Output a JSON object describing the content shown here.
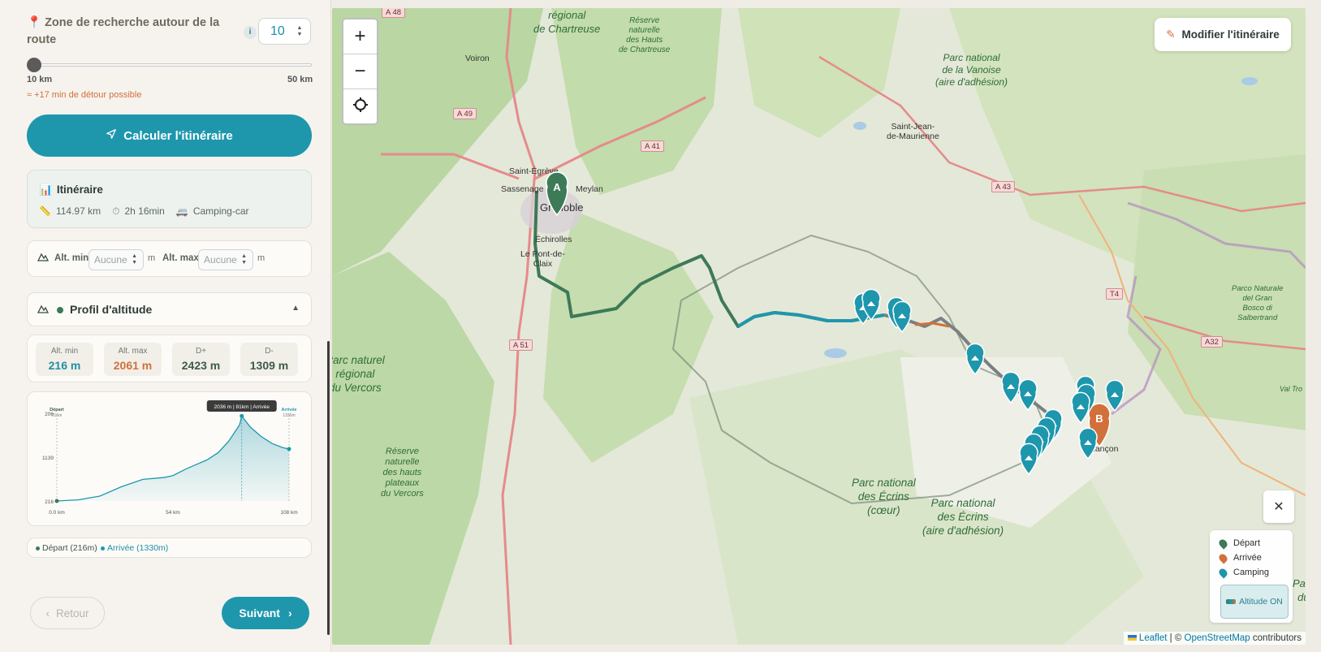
{
  "search_zone": {
    "title": "Zone de recherche autour de la route",
    "info": "i",
    "value": "10",
    "slider_min": "10 km",
    "slider_max": "50 km",
    "slider_level_fraction": 0,
    "detour": "≈ +17 min de détour possible"
  },
  "calc_button": "Calculer l'itinéraire",
  "itinerary": {
    "title": "Itinéraire",
    "distance": "114.97 km",
    "duration": "2h 16min",
    "vehicle": "Camping-car"
  },
  "alt_filter": {
    "min_label": "Alt. min",
    "min_placeholder": "Aucune",
    "max_label": "Alt. max",
    "max_placeholder": "Aucune",
    "unit": "m"
  },
  "profile": {
    "title": "Profil d'altitude",
    "stats": [
      {
        "label": "Alt. min",
        "value": "216 m",
        "color": "#1e8fa6"
      },
      {
        "label": "Alt. max",
        "value": "2061 m",
        "color": "#d2703b"
      },
      {
        "label": "D+",
        "value": "2423 m",
        "color": "#3d5a4c"
      },
      {
        "label": "D-",
        "value": "1309 m",
        "color": "#3d5a4c"
      }
    ],
    "legend_depart": "Départ (216m)",
    "legend_arrivee": "Arrivée (1330m)"
  },
  "chart_data": {
    "type": "area",
    "x": [
      0,
      10,
      20,
      30,
      40,
      50,
      54,
      60,
      65,
      70,
      75,
      80,
      85,
      86,
      90,
      95,
      100,
      105,
      108
    ],
    "y": [
      216,
      240,
      320,
      520,
      680,
      720,
      760,
      900,
      1000,
      1100,
      1250,
      1500,
      1850,
      2036,
      1800,
      1600,
      1450,
      1360,
      1330
    ],
    "ylim": [
      216,
      2061
    ],
    "y_ticks": [
      "206",
      "1139",
      "216"
    ],
    "x_ticks": [
      "0.0 km",
      "54 km",
      "108 km"
    ],
    "start_label": "Départ",
    "start_sub": "216m",
    "end_label": "Arrivée",
    "end_sub": "1330m",
    "tooltip": "2036 m | 81km | Arrivée",
    "color": "#1e97ad"
  },
  "nav": {
    "back": "Retour",
    "next": "Suivant"
  },
  "map": {
    "modify": "Modifier l'itinéraire",
    "zoom_in": "+",
    "zoom_out": "−",
    "legend": {
      "depart": "Départ",
      "arrivee": "Arrivée",
      "camping": "Camping",
      "altitude_toggle": "Altitude ON"
    },
    "attribution_leaflet": "Leaflet",
    "attribution_sep": "| ©",
    "attribution_osm": "OpenStreetMap",
    "attribution_rest": "contributors",
    "marker_a": "A",
    "marker_b": "B",
    "labels": {
      "chartreuse": "régional\nde Chartreuse",
      "reserve_chartreuse": "Réserve\nnaturelle\ndes Hauts\nde Chartreuse",
      "vanoise": "Parc national\nde la Vanoise\n(aire d'adhésion)",
      "vercors": "Parc naturel\nrégional\ndu Vercors",
      "reserve_vercors": "Réserve\nnaturelle\ndes hauts\nplateaux\ndu Vercors",
      "ecrins_coeur": "Parc national\ndes Écrins\n(cœur)",
      "ecrins_adhesion": "Parc national\ndes Écrins\n(aire d'adhésion)",
      "gran_bosco": "Parco Naturale\ndel Gran\nBosco di\nSalbertrand",
      "val_troncea": "Val Tro",
      "parco": "Parc\ndu"
    },
    "towns": {
      "voiron": "Voiron",
      "saint_egreve": "Saint-Égrève",
      "sassenage": "Sassenage",
      "meylan": "Meylan",
      "grenoble": "Grenoble",
      "echirolles": "Échirolles",
      "pont_de_claix": "Le Pont-de-\nClaix",
      "saint_jean": "Saint-Jean-\nde-Maurienne",
      "briancon": "Briançon"
    },
    "roads": [
      "A 48",
      "A 49",
      "A 41",
      "A 51",
      "A 43",
      "T4",
      "A32"
    ]
  }
}
